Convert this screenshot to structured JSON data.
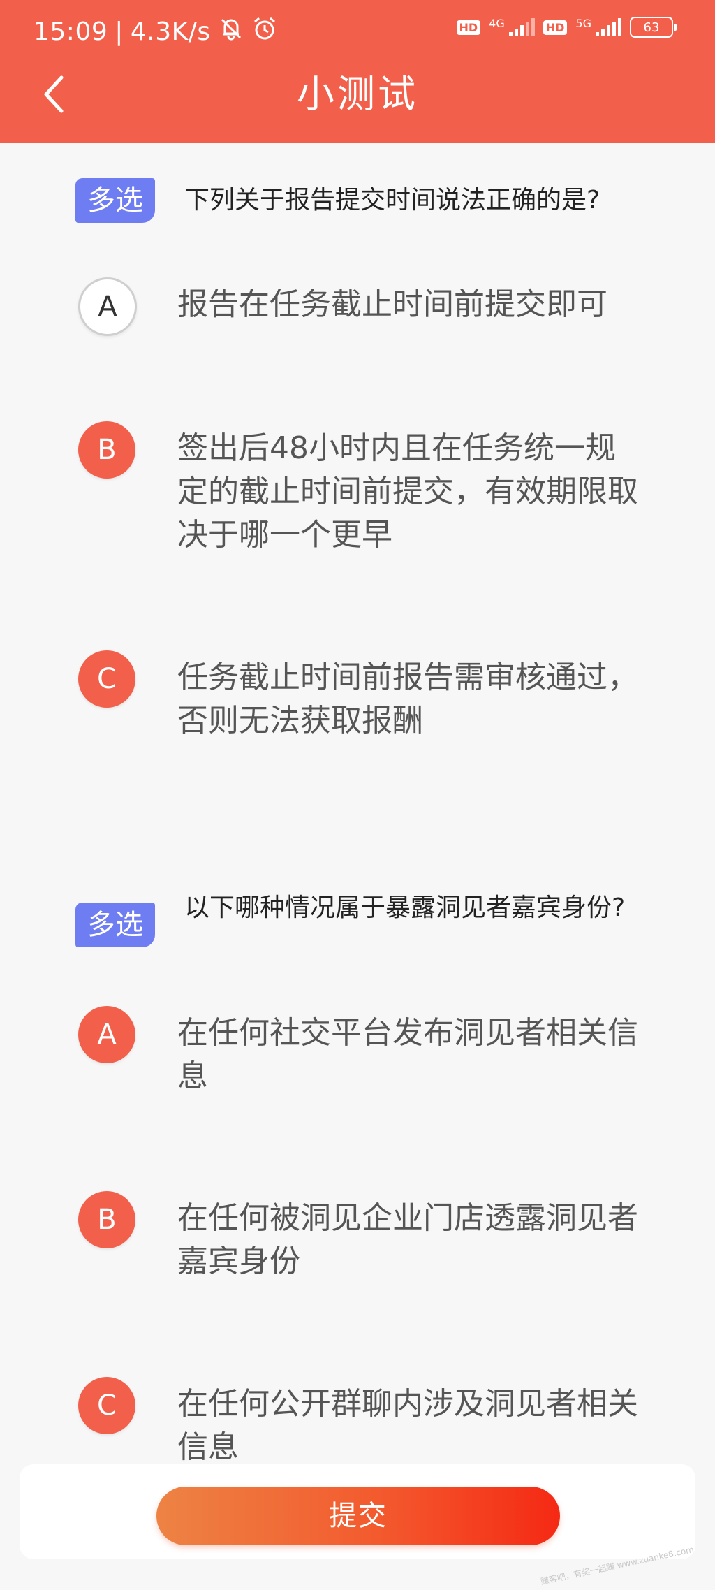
{
  "status_bar": {
    "time": "15:09",
    "separator": "|",
    "net_speed": "4.3K/s",
    "hd_label": "HD",
    "network_1": "4G",
    "network_2": "5G",
    "battery": "63"
  },
  "header": {
    "title": "小测试"
  },
  "questions": [
    {
      "tag": "多选",
      "text": "下列关于报告提交时间说法正确的是?",
      "options": [
        {
          "letter": "A",
          "text": "报告在任务截止时间前提交即可",
          "selected": false
        },
        {
          "letter": "B",
          "text": "签出后48小时内且在任务统一规定的截止时间前提交，有效期限取决于哪一个更早",
          "selected": true
        },
        {
          "letter": "C",
          "text": "任务截止时间前报告需审核通过，否则无法获取报酬",
          "selected": true
        }
      ]
    },
    {
      "tag": "多选",
      "text": "以下哪种情况属于暴露洞见者嘉宾身份?",
      "options": [
        {
          "letter": "A",
          "text": "在任何社交平台发布洞见者相关信息",
          "selected": true
        },
        {
          "letter": "B",
          "text": "在任何被洞见企业门店透露洞见者嘉宾身份",
          "selected": true
        },
        {
          "letter": "C",
          "text": "在任何公开群聊内涉及洞见者相关信息",
          "selected": true
        }
      ]
    }
  ],
  "footer": {
    "submit_label": "提交"
  },
  "watermark": "赚客吧，有奖一起赚 www.zuanke8.com",
  "colors": {
    "brand": "#f2604c",
    "tag": "#6f7df2",
    "selected": "#f2604c"
  }
}
